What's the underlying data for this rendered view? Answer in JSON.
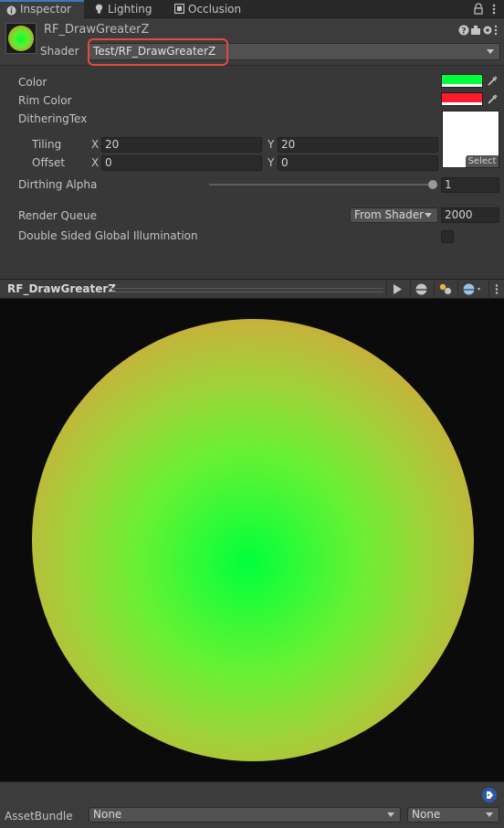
{
  "tabs": [
    {
      "label": "Inspector",
      "active": true,
      "icon": "info-icon"
    },
    {
      "label": "Lighting",
      "active": false,
      "icon": "bulb-icon"
    },
    {
      "label": "Occlusion",
      "active": false,
      "icon": "occlusion-icon"
    }
  ],
  "header": {
    "material_name": "RF_DrawGreaterZ",
    "shader_label": "Shader",
    "shader_value": "Test/RF_DrawGreaterZ",
    "highlight_color": "#e8483f"
  },
  "properties": {
    "color": {
      "label": "Color",
      "value": "#00ff3c"
    },
    "rim_color": {
      "label": "Rim Color",
      "value": "#ff1a30"
    },
    "dithering": {
      "label": "DitheringTex",
      "select_label": "Select",
      "tiling": {
        "label": "Tiling",
        "x_label": "X",
        "x": "20",
        "y_label": "Y",
        "y": "20"
      },
      "offset": {
        "label": "Offset",
        "x_label": "X",
        "x": "0",
        "y_label": "Y",
        "y": "0"
      }
    },
    "dithering_alpha": {
      "label": "Dirthing Alpha",
      "value": "1",
      "slider_fraction": 1.0
    },
    "render_queue": {
      "label": "Render Queue",
      "mode": "From Shader",
      "value": "2000"
    },
    "double_sided_gi": {
      "label": "Double Sided Global Illumination",
      "checked": false
    }
  },
  "preview": {
    "title": "RF_DrawGreaterZ",
    "buttons": [
      "play-icon",
      "sphere-icon",
      "light-icon",
      "background-icon",
      "more-icon"
    ],
    "background": "#0b0b0b",
    "accent_center": "#00ff3c",
    "accent_rim": "#ff3e1c"
  },
  "asset_bundle": {
    "label": "AssetBundle",
    "bundle_value": "None",
    "variant_value": "None"
  }
}
